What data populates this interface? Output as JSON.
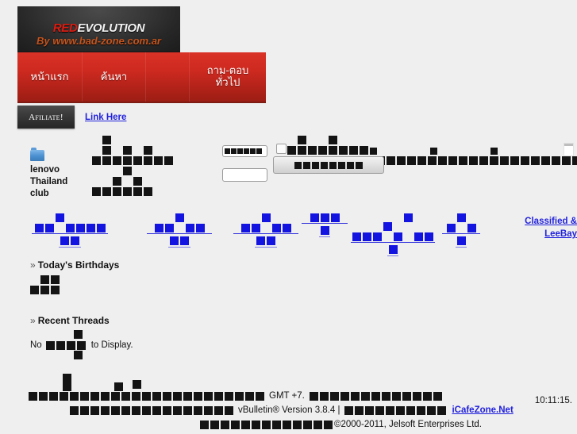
{
  "site": {
    "logo_title_red": "RED",
    "logo_title_rest": "EVOLUTION",
    "logo_subtitle": "By www.bad-zone.com.ar"
  },
  "nav": {
    "items": [
      {
        "label": "หน้าแรก",
        "name": "nav-home"
      },
      {
        "label": "ค้นหา",
        "name": "nav-search"
      },
      {
        "label": "",
        "name": "nav-blank"
      },
      {
        "label": "ถาม-ตอบ\nทั่วไป",
        "name": "nav-qa"
      }
    ],
    "qa_line1": "ถาม-ตอบ",
    "qa_line2": "ทั่วไป"
  },
  "affiliate": {
    "badge": "Afiliate!",
    "link": "Link Here"
  },
  "forum": {
    "folder_label": "lenovo\nThailand\nclub",
    "folder_label_l1": "lenovo",
    "folder_label_l2": "Thailand",
    "folder_label_l3": "club",
    "search_value_glyphs": 6,
    "search_input2_value": "",
    "button_glyphs": 8,
    "paren_open": "(",
    "paren_close": ")"
  },
  "side_links": {
    "classified_line1": "Classified &",
    "classified_line2": "LeeBay"
  },
  "birthdays": {
    "chevron": "»",
    "title": "Today's Birthdays"
  },
  "recent": {
    "chevron": "»",
    "title": "Recent Threads",
    "no_text": "No",
    "display_text": "to Display."
  },
  "footer": {
    "gmt": "GMT +7.",
    "clock": "10:11:15.",
    "vbulletin": "vBulletin® Version 3.8.4 |",
    "icafe_link": "iCafeZone.Net",
    "copyright": "©2000-2011, Jelsoft Enterprises Ltd."
  },
  "colors": {
    "page_bg": "#efefef",
    "nav_red_top": "#d93227",
    "nav_red_bottom": "#9c1d14",
    "logo_red": "#e01b10",
    "logo_sub": "#c4541e",
    "link_blue": "#2121dd",
    "tofu_black": "#141414",
    "tofu_blue": "#1414e0"
  }
}
